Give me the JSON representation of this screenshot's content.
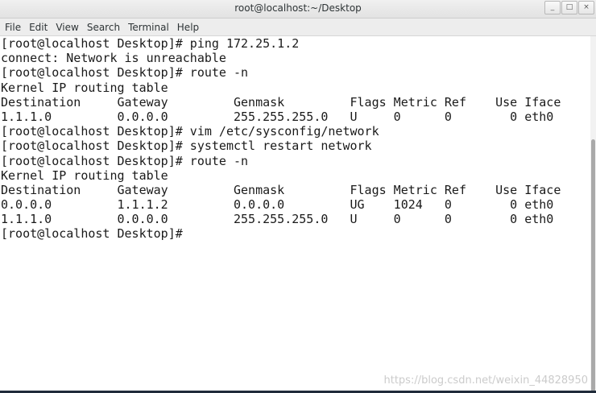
{
  "window": {
    "title": "root@localhost:~/Desktop",
    "controls": {
      "minimize": "_",
      "maximize": "□",
      "close": "×"
    }
  },
  "menubar": {
    "items": [
      "File",
      "Edit",
      "View",
      "Search",
      "Terminal",
      "Help"
    ]
  },
  "terminal": {
    "lines": [
      "[root@localhost Desktop]# ping 172.25.1.2",
      "connect: Network is unreachable",
      "[root@localhost Desktop]# route -n",
      "Kernel IP routing table",
      "Destination     Gateway         Genmask         Flags Metric Ref    Use Iface",
      "1.1.1.0         0.0.0.0         255.255.255.0   U     0      0        0 eth0",
      "[root@localhost Desktop]# vim /etc/sysconfig/network",
      "[root@localhost Desktop]# systemctl restart network",
      "[root@localhost Desktop]# route -n",
      "Kernel IP routing table",
      "Destination     Gateway         Genmask         Flags Metric Ref    Use Iface",
      "0.0.0.0         1.1.1.2         0.0.0.0         UG    1024   0        0 eth0",
      "1.1.1.0         0.0.0.0         255.255.255.0   U     0      0        0 eth0",
      "[root@localhost Desktop]# "
    ]
  },
  "watermark": "https://blog.csdn.net/weixin_44828950"
}
